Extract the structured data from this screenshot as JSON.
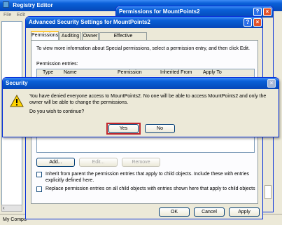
{
  "registry_editor": {
    "title": "Registry Editor",
    "menu": [
      "File",
      "Edit"
    ],
    "status": "My Compu"
  },
  "permissions_dialog": {
    "title": "Permissions for MountPoints2",
    "help": "?",
    "close": "×"
  },
  "advanced_dialog": {
    "title": "Advanced Security Settings for MountPoints2",
    "help": "?",
    "close": "×",
    "tabs": [
      "Permissions",
      "Auditing",
      "Owner",
      "Effective Permissions"
    ],
    "intro": "To view more information about Special permissions, select a permission entry, and then click Edit.",
    "entries_label": "Permission entries:",
    "columns": [
      "Type",
      "Name",
      "Permission",
      "Inherited From",
      "Apply To"
    ],
    "add_label": "Add...",
    "edit_label": "Edit...",
    "remove_label": "Remove",
    "inherit_text": "Inherit from parent the permission entries that apply to child objects. Include these with entries explicitly defined here.",
    "replace_text": "Replace permission entries on all child objects with entries shown here that apply to child objects",
    "ok_label": "OK",
    "cancel_label": "Cancel",
    "apply_label": "Apply"
  },
  "security_dialog": {
    "title": "Security",
    "close": "×",
    "message": "You have denied everyone access to MountPoints2. No one will be able to access MountPoints2 and only the owner will be able to change the permissions.",
    "question": "Do you wish to continue?",
    "yes_label": "Yes",
    "no_label": "No",
    "warning_glyph": "!"
  }
}
